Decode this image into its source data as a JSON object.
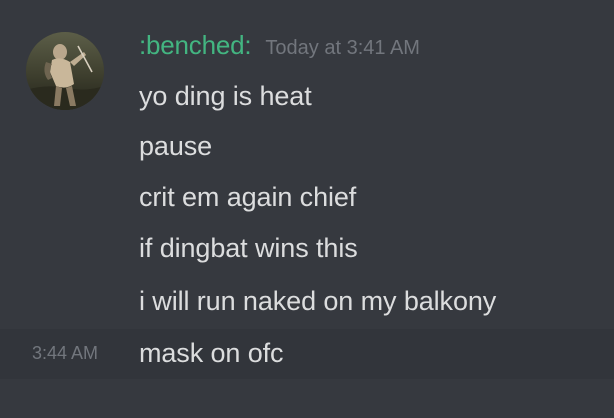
{
  "message_group": {
    "author": {
      "username": ":benched:",
      "avatar_icon": "user-avatar-photo",
      "name_color": "#43b581"
    },
    "timestamp": "Today at 3:41 AM",
    "messages": [
      {
        "text": "yo ding is heat"
      },
      {
        "text": "pause"
      },
      {
        "text": "crit em again chief"
      },
      {
        "text": "if dingbat wins this"
      },
      {
        "text": "i will run naked on my balkony"
      },
      {
        "text": "mask on ofc",
        "side_timestamp": "3:44 AM",
        "hovered": true
      }
    ]
  },
  "colors": {
    "background": "#36393f",
    "hover_background": "#32353b",
    "message_text": "#dcddde",
    "muted_text": "#72767d"
  }
}
